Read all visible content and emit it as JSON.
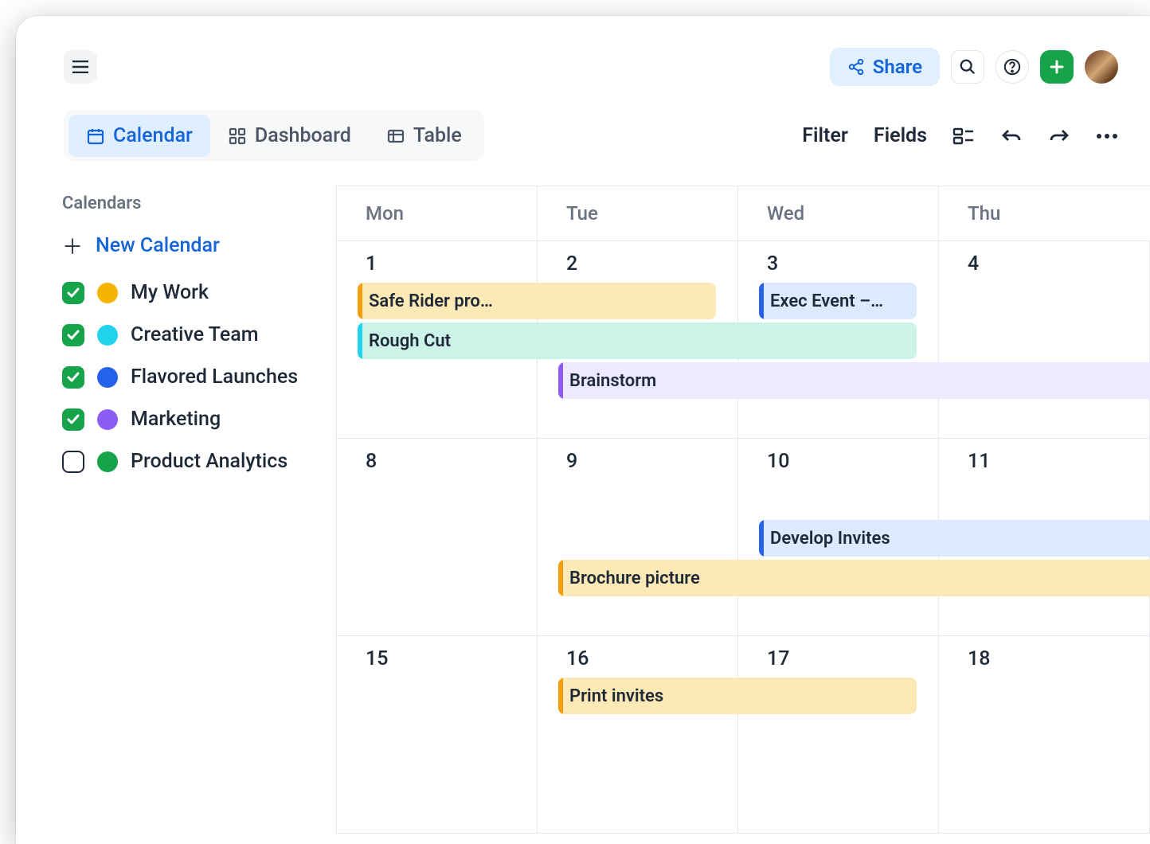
{
  "topbar": {
    "share_label": "Share"
  },
  "views": {
    "calendar": "Calendar",
    "dashboard": "Dashboard",
    "table": "Table"
  },
  "controls": {
    "filter": "Filter",
    "fields": "Fields"
  },
  "sidebar": {
    "heading": "Calendars",
    "new_label": "New Calendar",
    "items": [
      {
        "label": "My Work",
        "color": "#f5b400",
        "checked": true
      },
      {
        "label": "Creative Team",
        "color": "#22d3ee",
        "checked": true
      },
      {
        "label": "Flavored Launches",
        "color": "#2563eb",
        "checked": true
      },
      {
        "label": "Marketing",
        "color": "#8b5cf6",
        "checked": true
      },
      {
        "label": "Product Analytics",
        "color": "#16a34a",
        "checked": false
      }
    ]
  },
  "calendar": {
    "day_headers": [
      "Mon",
      "Tue",
      "Wed",
      "Thu"
    ],
    "weeks": [
      [
        "1",
        "2",
        "3",
        "4"
      ],
      [
        "8",
        "9",
        "10",
        "11"
      ],
      [
        "15",
        "16",
        "17",
        "18"
      ]
    ],
    "events": {
      "safe_rider": "Safe Rider pro…",
      "exec_event": "Exec Event –…",
      "rough_cut": "Rough Cut",
      "brainstorm": "Brainstorm",
      "develop_invites": "Develop Invites",
      "brochure": "Brochure picture",
      "print_invites": "Print invites"
    }
  },
  "colors": {
    "orange": "#f59e0b",
    "orange_bg": "#fde9b6",
    "blue": "#2563eb",
    "blue_bg": "#dbeafe",
    "teal": "#22d3ee",
    "teal_bg": "#ccf3e8",
    "purple": "#8b5cf6",
    "purple_bg": "#ede9fe"
  }
}
